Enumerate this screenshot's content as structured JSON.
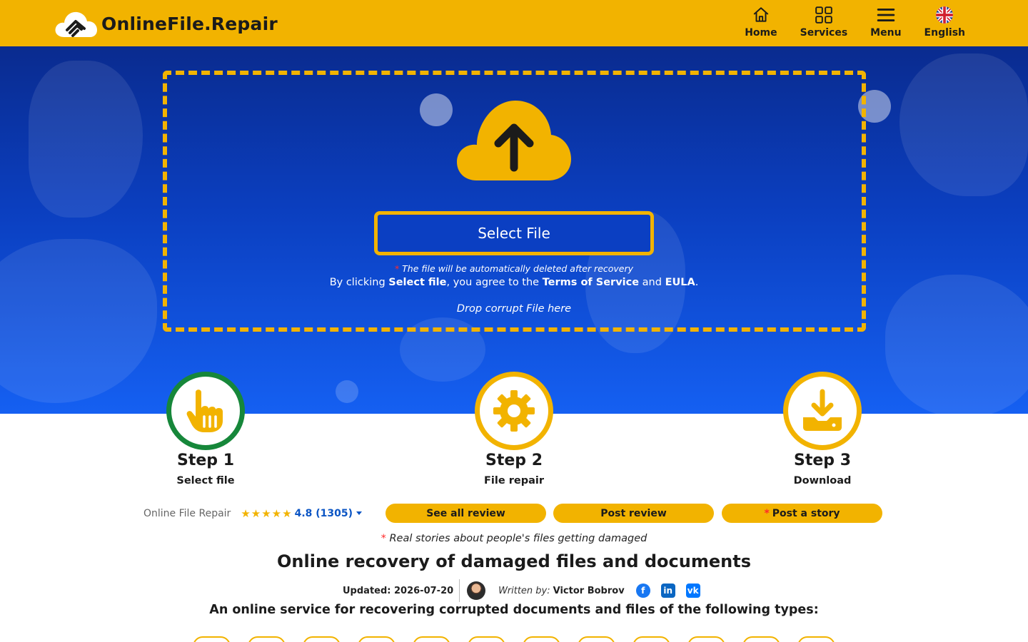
{
  "header": {
    "brand": "OnlineFile.Repair",
    "nav": [
      {
        "label": "Home",
        "icon": "home-icon"
      },
      {
        "label": "Services",
        "icon": "grid-icon"
      },
      {
        "label": "Menu",
        "icon": "hamburger-icon"
      },
      {
        "label": "English",
        "icon": "uk-flag-icon"
      }
    ]
  },
  "upload": {
    "select_label": "Select File",
    "auto_delete_note": "The file will be automatically deleted after recovery",
    "asterisk": "*",
    "agree_prefix": "By clicking ",
    "agree_select": "Select file",
    "agree_mid": ", you agree to the ",
    "agree_terms": "Terms of Service",
    "agree_and": " and ",
    "agree_eula": "EULA",
    "agree_end": ".",
    "drop_hint": "Drop corrupt File here"
  },
  "steps": [
    {
      "title": "Step 1",
      "subtitle": "Select file",
      "icon": "pointer-hand-icon",
      "ring": "#16873a"
    },
    {
      "title": "Step 2",
      "subtitle": "File repair",
      "icon": "gear-icon",
      "ring": "#f2b300"
    },
    {
      "title": "Step 3",
      "subtitle": "Download",
      "icon": "download-icon",
      "ring": "#f2b300"
    }
  ],
  "reviews": {
    "label": "Online File Repair",
    "stars": 5,
    "rating_text": "4.8 (1305)",
    "see_all": "See all review",
    "post_review": "Post review",
    "post_story_star": "*",
    "post_story": "Post a story"
  },
  "stories_note": "Real stories about people's files getting damaged",
  "main": {
    "title": "Online recovery of damaged files and documents",
    "updated": "Updated: 2026-07-20",
    "written_by": "Written by:",
    "author": "Victor Bobrov",
    "subtitle": "An online service for recovering corrupted documents and files of the following types:"
  },
  "social": [
    "facebook-icon",
    "linkedin-icon",
    "vk-icon"
  ],
  "colors": {
    "accent": "#f2b300",
    "hero_top": "#0a2b8f",
    "hero_bottom": "#1560f2",
    "link": "#0b55c4"
  }
}
